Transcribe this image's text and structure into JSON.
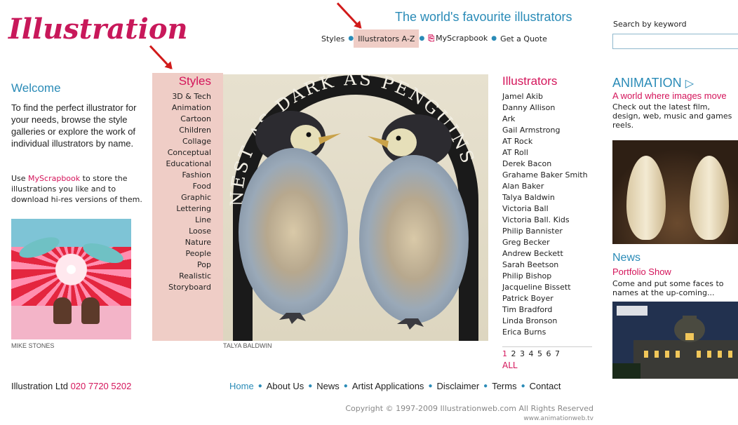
{
  "brand": {
    "logo_text": "Illustration",
    "tagline": "The world's favourite illustrators"
  },
  "header_nav": {
    "items": [
      "Styles",
      "Illustrators A-Z",
      "MyScrapbook",
      "Get a Quote"
    ]
  },
  "search": {
    "label": "Search by keyword",
    "value": ""
  },
  "welcome": {
    "title": "Welcome",
    "text": "To find the perfect illustrator for your needs, browse the style galleries or explore the work of individual illustrators by name.",
    "scrapbook_pre": "Use ",
    "scrapbook_link": "MyScrapbook",
    "scrapbook_post": " to store the illustrations you like and to download hi-res versions of them.",
    "thumb_caption": "MIKE STONES"
  },
  "styles": {
    "title": "Styles",
    "items": [
      "3D & Tech",
      "Animation",
      "Cartoon",
      "Children",
      "Collage",
      "Conceptual",
      "Educational",
      "Fashion",
      "Food",
      "Graphic",
      "Lettering",
      "Line",
      "Loose",
      "Nature",
      "People",
      "Pop",
      "Realistic",
      "Storyboard"
    ]
  },
  "feature": {
    "caption": "TALYA BALDWIN",
    "artwork_text": "NEST AS DARK AS PENGUINS"
  },
  "illustrators": {
    "title": "Illustrators",
    "items": [
      "Jamel Akib",
      "Danny Allison",
      "Ark",
      "Gail Armstrong",
      "AT Rock",
      "AT Roll",
      "Derek Bacon",
      "Grahame Baker Smith",
      "Alan Baker",
      "Talya Baldwin",
      "Victoria Ball",
      "Victoria Ball. Kids",
      "Philip Bannister",
      "Greg Becker",
      "Andrew Beckett",
      "Sarah Beetson",
      "Philip Bishop",
      "Jacqueline Bissett",
      "Patrick Boyer",
      "Tim Bradford",
      "Linda Bronson",
      "Erica Burns"
    ],
    "pages": [
      "1",
      "2",
      "3",
      "4",
      "5",
      "6",
      "7"
    ],
    "current_page": "1",
    "all_label": "ALL"
  },
  "animation": {
    "title": "ANIMATION",
    "subtitle": "A world where images move",
    "text": "Check out the latest film, design, web, music and games reels."
  },
  "news": {
    "title": "News",
    "subtitle": "Portfolio Show",
    "text": "Come and put some faces to",
    "text2": "names at the up-coming..."
  },
  "footer": {
    "company": "Illustration Ltd",
    "phone": "020 7720 5202",
    "nav": [
      "Home",
      "About Us",
      "News",
      "Artist Applications",
      "Disclaimer",
      "Terms",
      "Contact"
    ],
    "copyright": "Copyright © 1997-2009 Illustrationweb.com All Rights Reserved",
    "sitelink": "www.animationweb.tv"
  },
  "colors": {
    "brand_pink": "#d4145a",
    "teal": "#2a8bb7",
    "highlight": "#efcdc6",
    "annotation_arrow": "#d11a1a"
  }
}
